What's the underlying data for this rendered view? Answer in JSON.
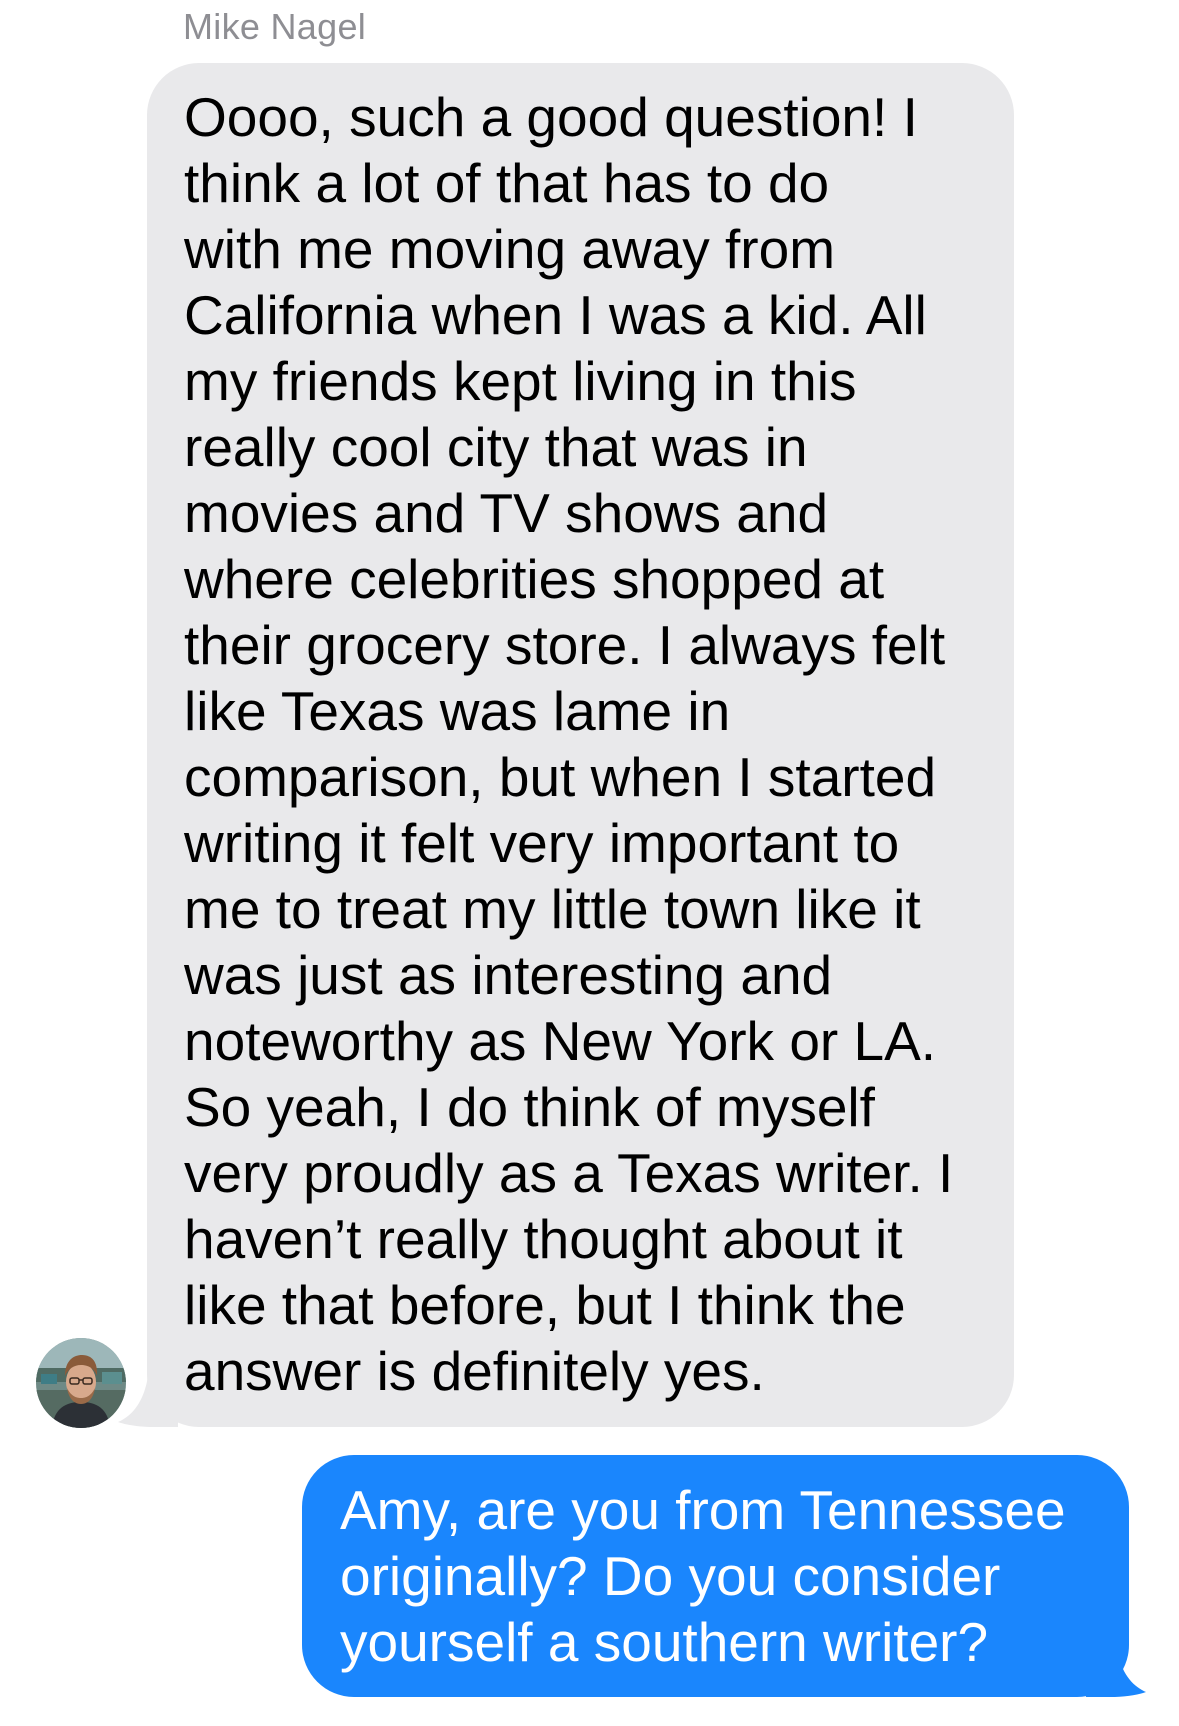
{
  "conversation": {
    "incoming": {
      "sender_name": "Mike Nagel",
      "text": "Oooo, such a good question! I\nthink a lot of that has to do\nwith me moving away from\nCalifornia when I was a kid. All\nmy friends kept living in this\nreally cool city that was in\nmovies and TV shows and\nwhere celebrities shopped at\ntheir grocery store. I always felt\nlike Texas was lame in\ncomparison, but when I started\nwriting it felt very important to\nme to treat my little town like it\nwas just as interesting and\nnoteworthy as New York or LA.\nSo yeah, I do think of myself\nvery proudly as a Texas writer. I\nhaven’t really thought about it\nlike that before, but I think the\nanswer is definitely yes.",
      "bubble_color": "#e9e9eb"
    },
    "outgoing": {
      "text": "Amy, are you from Tennessee\noriginally? Do you consider\nyourself a southern writer?",
      "bubble_color": "#1a86fd"
    },
    "avatar_icon": "avatar-photo-icon"
  }
}
